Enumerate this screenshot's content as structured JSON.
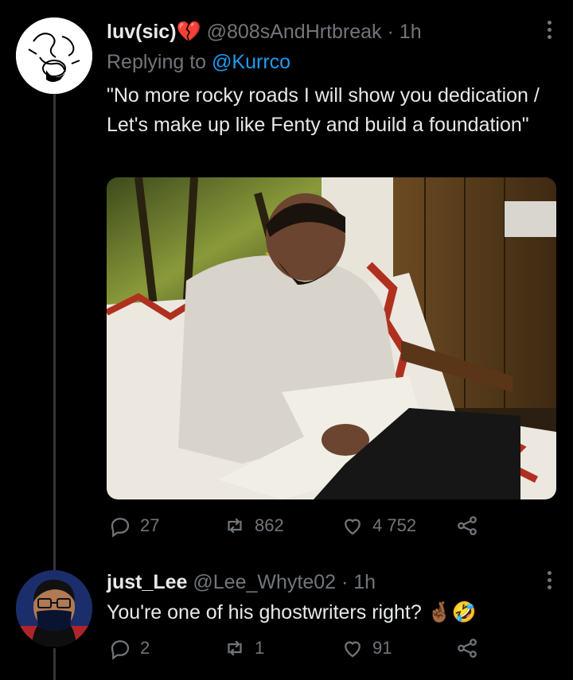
{
  "tweet": {
    "display_name": "luv(sic)",
    "name_emoji": "💔",
    "handle": "@808sAndHrtbreak",
    "time": "1h",
    "reply_prefix": "Replying to",
    "reply_to": "@Kurrco",
    "text": "\"No more rocky roads I will show you dedication / Let's make up like Fenty and build a foundation\"",
    "counts": {
      "replies": "27",
      "retweets": "862",
      "likes": "4 752"
    }
  },
  "reply": {
    "display_name": "just_Lee",
    "handle": "@Lee_Whyte02",
    "time": "1h",
    "text": "You're one of his ghostwriters right?",
    "emojis": "🤞🏾🤣",
    "counts": {
      "replies": "2",
      "retweets": "1",
      "likes": "91"
    }
  },
  "separator": "·",
  "colors": {
    "background": "#000000",
    "text": "#e7e9ea",
    "secondary": "#71767b",
    "link": "#1d9bf0"
  },
  "icons": [
    "more-icon",
    "reply-icon",
    "retweet-icon",
    "like-icon",
    "share-icon"
  ]
}
